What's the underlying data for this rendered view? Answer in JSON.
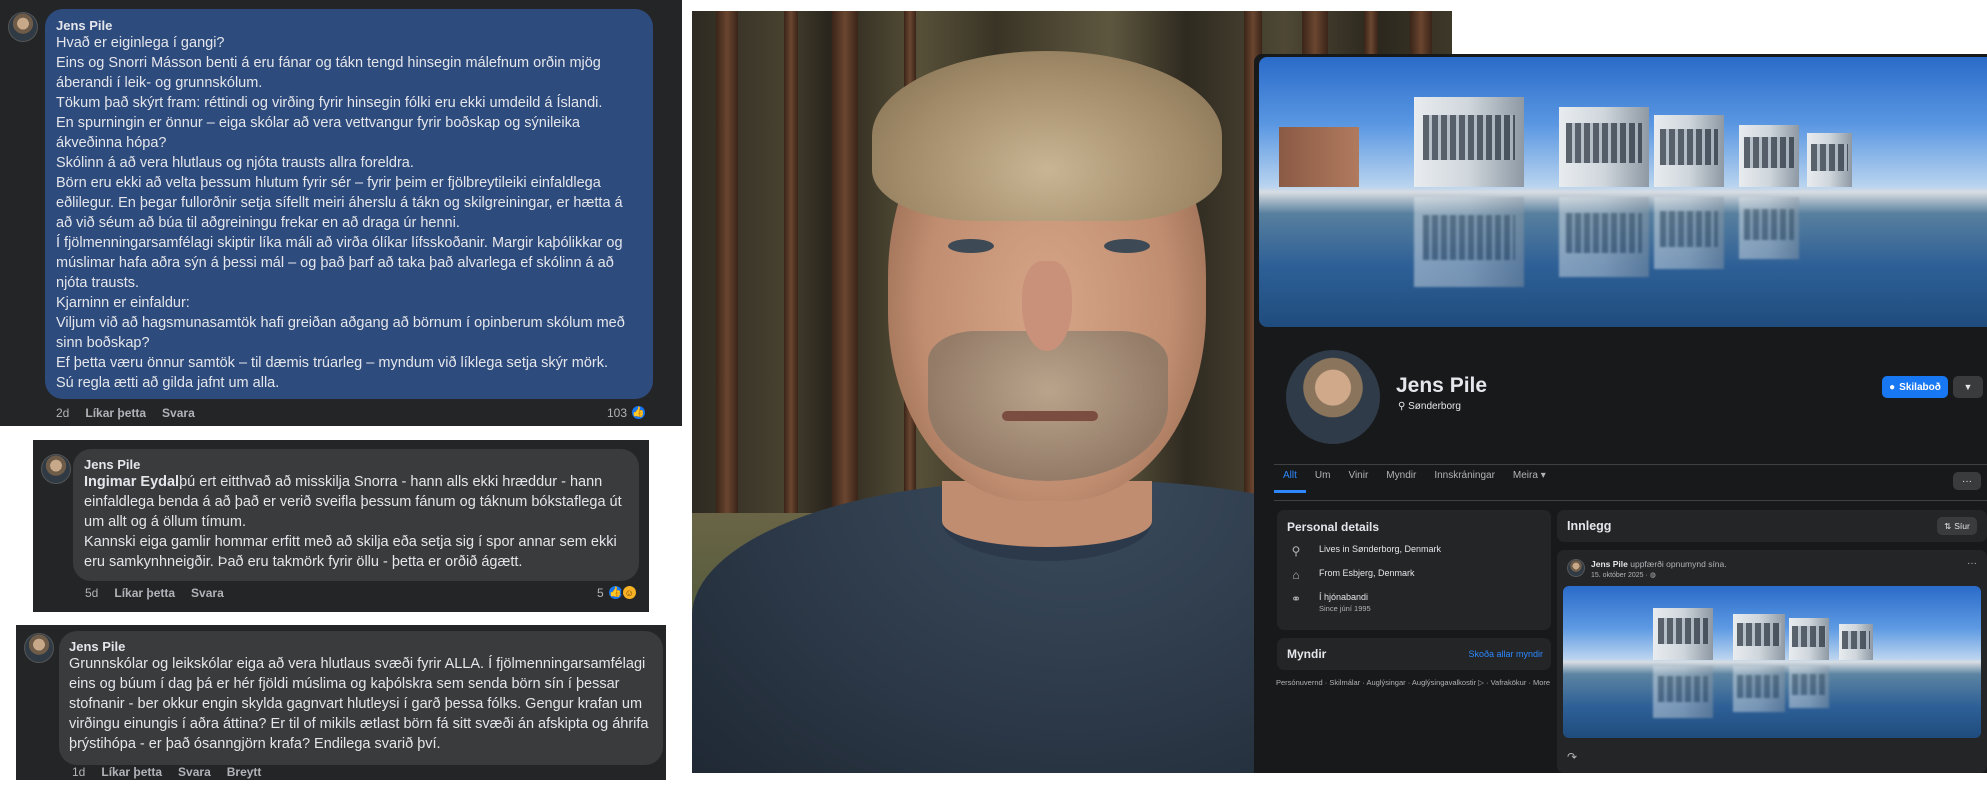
{
  "comments": [
    {
      "author": "Jens Pile",
      "text": "Hvað er eiginlega í gangi?\nEins og Snorri Másson benti á eru fánar og tákn tengd hinsegin málefnum orðin mjög áberandi í leik- og grunnskólum.\nTökum það skýrt fram: réttindi og virðing fyrir hinsegin fólki eru ekki umdeild á Íslandi.\nEn spurningin er önnur – eiga skólar að vera vettvangur fyrir boðskap og sýnileika ákveðinna hópa?\nSkólinn á að vera hlutlaus og njóta trausts allra foreldra.\nBörn eru ekki að velta þessum hlutum fyrir sér – fyrir þeim er fjölbreytileiki einfaldlega eðlilegur. En þegar fullorðnir setja sífellt meiri áherslu á tákn og skilgreiningar, er hætta á að við séum að búa til aðgreiningu frekar en að draga úr henni.\nÍ fjölmenningarsamfélagi skiptir líka máli að virða ólíkar lífsskoðanir. Margir kaþólikkar og múslimar hafa aðra sýn á þessi mál – og það þarf að taka það alvarlega ef skólinn á að njóta trausts.\nKjarninn er einfaldur:\nViljum við að hagsmunasamtök hafi greiðan aðgang að börnum í opinberum skólum með sinn boðskap?\nEf þetta væru önnur samtök – til dæmis trúarleg – myndum við líklega setja skýr mörk.\nSú regla ætti að gilda jafnt um alla.",
      "time": "2d",
      "like": "Líkar þetta",
      "reply": "Svara",
      "reactions": "103"
    },
    {
      "author": "Jens Pile",
      "mention": "Ingimar Eydal",
      "text": "þú ert eitthvað að misskilja Snorra - hann alls ekki hræddur - hann einfaldlega benda á að það er verið sveifla þessum fánum og táknum bókstaflega út um allt og á öllum tímum.\nKannski eiga gamlir hommar erfitt með að skilja eða setja sig í spor annar sem ekki eru samkynhneigðir. Það eru takmörk fyrir öllu - þetta er orðið ágætt.",
      "time": "5d",
      "like": "Líkar þetta",
      "reply": "Svara",
      "reactions": "5"
    },
    {
      "author": "Jens Pile",
      "text": "Grunnskólar og leikskólar eiga að vera hlutlaus svæði fyrir ALLA. Í fjölmenningarsamfélagi eins og búum í dag þá er hér fjöldi múslima og kaþólskra sem senda börn sín í þessar stofnanir - ber okkur engin skylda gagnvart hlutleysi í garð þessa fólks. Gengur krafan um virðingu einungis í aðra áttina? Er til of mikils ætlast börn fá sitt svæði án afskipta og áhrifa þrýstihópa - er það ósanngjörn krafa? Endilega svarið því.",
      "time": "1d",
      "like": "Líkar þetta",
      "reply": "Svara",
      "edit": "Breytt"
    }
  ],
  "profile": {
    "name": "Jens Pile",
    "location": "Sønderborg",
    "message_button": "Skilaboð",
    "tabs": [
      "Allt",
      "Um",
      "Vinir",
      "Myndir",
      "Innskráningar",
      "Meira ▾"
    ],
    "personal_details_title": "Personal details",
    "details": [
      {
        "icon": "location-pin-icon",
        "text": "Lives in Sønderborg, Denmark",
        "sub": ""
      },
      {
        "icon": "home-icon",
        "text": "From Esbjerg, Denmark",
        "sub": ""
      },
      {
        "icon": "relationship-icon",
        "text": "Í hjónabandi",
        "sub": "Since júní 1995"
      }
    ],
    "photos_title": "Myndir",
    "photos_link": "Skoða allar myndir",
    "footer": "Persónuvernd · Skilmálar · Auglýsingar · Auglýsingavalkostir ▷ · Vafrakökur · More",
    "posts_title": "Innlegg",
    "filter_label": "Síur",
    "post": {
      "author": "Jens Pile",
      "action": "uppfærði opnumynd sína.",
      "date": "15. október 2025 · ◍"
    }
  },
  "colors": {
    "panel_bg": "#242526",
    "bubble_bg": "#3a3b3c",
    "highlight_bubble_bg": "#2e4b7d",
    "profile_bg": "#18191a",
    "accent": "#1877f2"
  }
}
